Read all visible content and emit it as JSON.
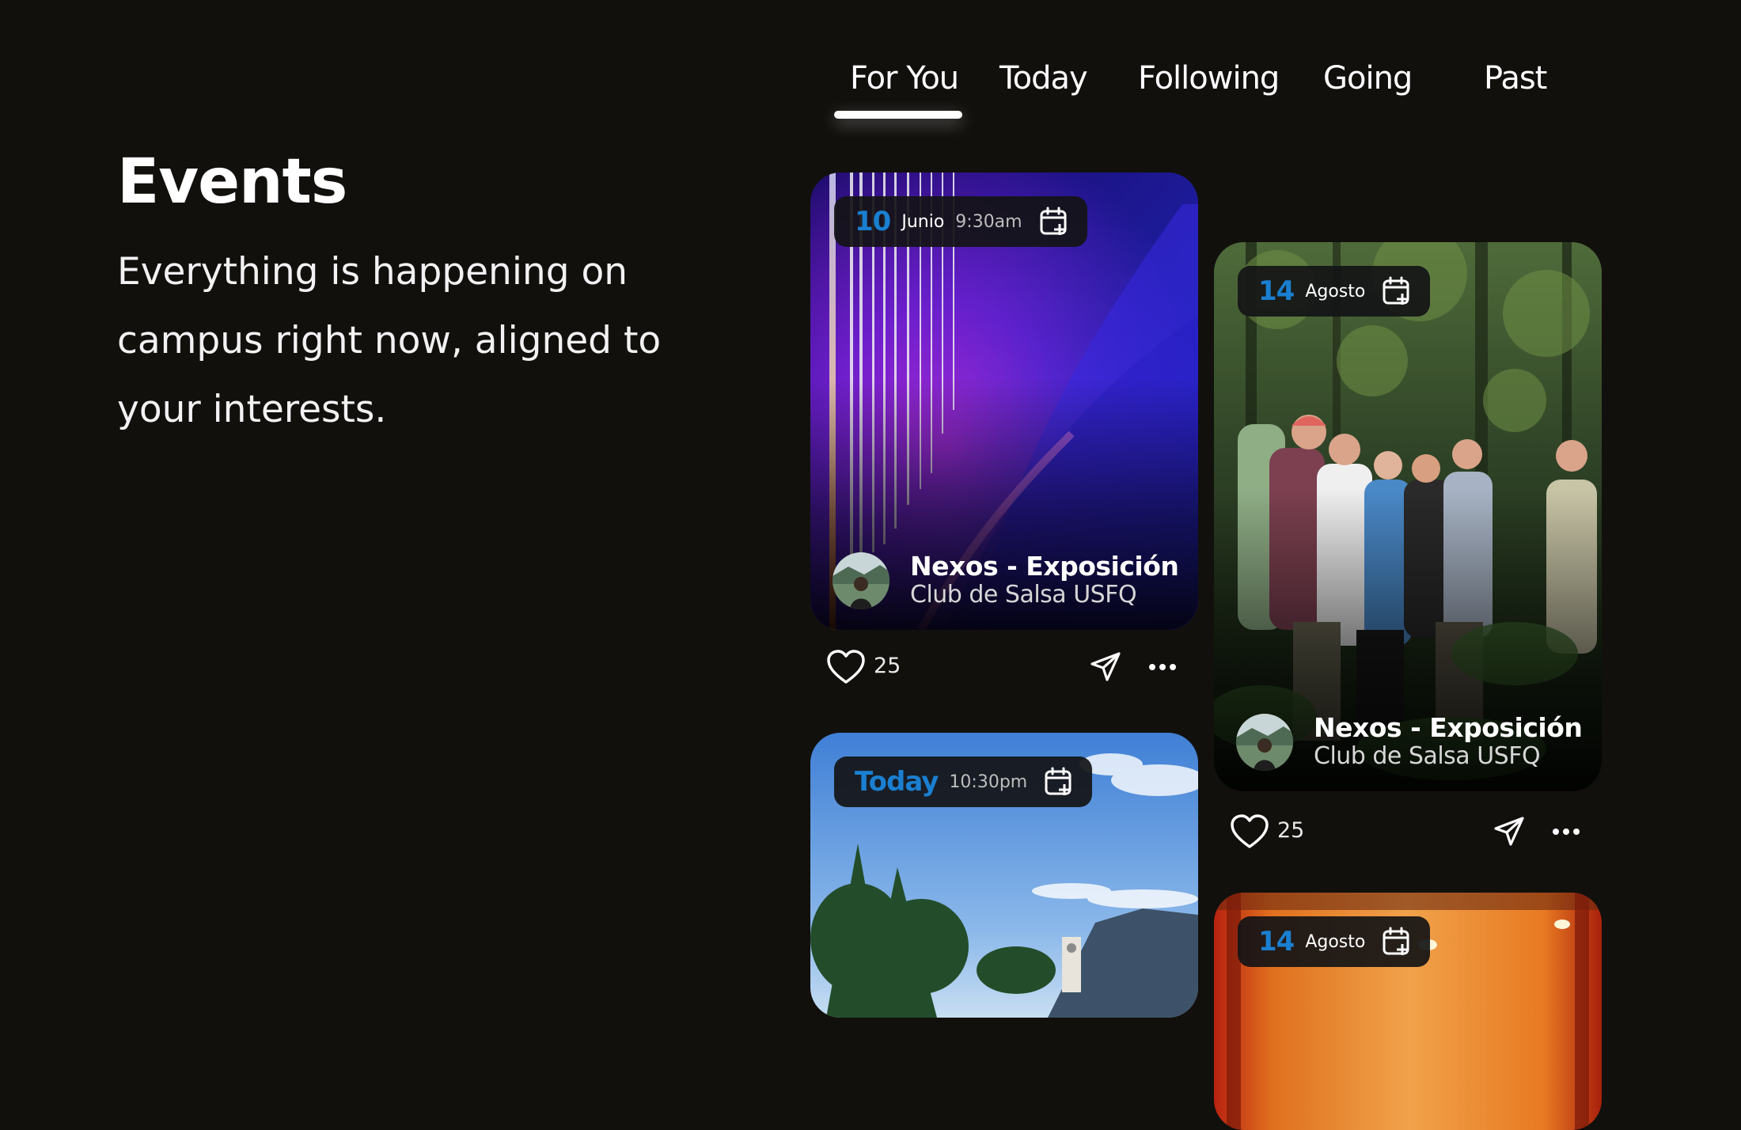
{
  "header": {
    "title": "Events",
    "subtitle": "Everything is happening on campus right now, aligned to your interests."
  },
  "tabs": [
    {
      "label": "For You",
      "active": true
    },
    {
      "label": "Today",
      "active": false
    },
    {
      "label": "Following",
      "active": false
    },
    {
      "label": "Going",
      "active": false
    },
    {
      "label": "Past",
      "active": false
    }
  ],
  "events": [
    {
      "day": "10",
      "month": "Junio",
      "time": "9:30am",
      "title": "Nexos - Exposición",
      "organizer": "Club de Salsa USFQ",
      "likes": "25",
      "image": "abstract-purple-lights"
    },
    {
      "day": "14",
      "month": "Agosto",
      "time": "",
      "title": "Nexos - Exposición",
      "organizer": "Club de Salsa USFQ",
      "likes": "25",
      "image": "forest-field-trip-group"
    },
    {
      "day": "Today",
      "month": "",
      "time": "10:30pm",
      "image": "campus-sky-trees-tower"
    },
    {
      "day": "14",
      "month": "Agosto",
      "time": "",
      "image": "orange-interior-lights"
    }
  ],
  "colors": {
    "background": "#12100d",
    "accent_blue": "#1a7fd0",
    "text_primary": "#ffffff",
    "text_secondary": "#d6d6d6"
  },
  "icons": {
    "calendar_add": "calendar-plus-icon",
    "like": "heart-icon",
    "share": "send-icon",
    "more": "ellipsis-icon"
  }
}
